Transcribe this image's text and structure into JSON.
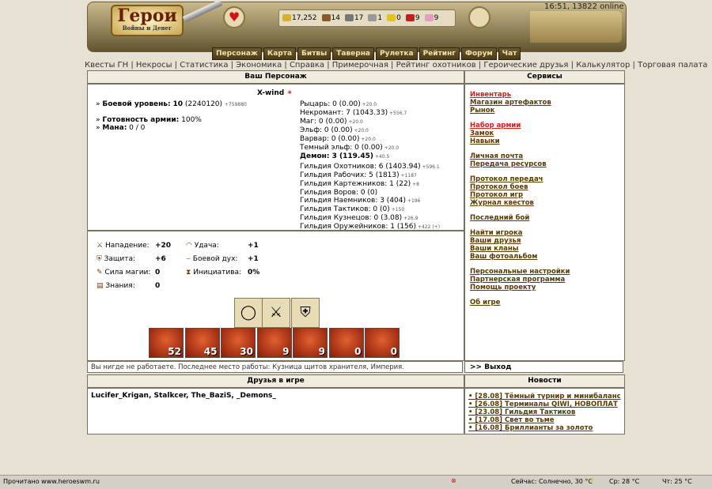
{
  "header": {
    "logo": "Герои",
    "logo_sub": "Войны и Денег",
    "clock": "16:51, 13822 online",
    "resources": [
      {
        "name": "gold",
        "value": "17,252",
        "color": "#d8b030"
      },
      {
        "name": "wood",
        "value": "14",
        "color": "#8a5a2a"
      },
      {
        "name": "ore",
        "value": "17",
        "color": "#777777"
      },
      {
        "name": "mercury",
        "value": "1",
        "color": "#999999"
      },
      {
        "name": "sulfur",
        "value": "0",
        "color": "#e8c020"
      },
      {
        "name": "crystals",
        "value": "9",
        "color": "#c02020"
      },
      {
        "name": "gems",
        "value": "9",
        "color": "#e0a0c0"
      }
    ]
  },
  "menu": [
    "Персонаж",
    "Карта",
    "Битвы",
    "Таверна",
    "Рулетка",
    "Рейтинг",
    "Форум",
    "Чат"
  ],
  "links": [
    "Квесты ГН",
    "Некросы",
    "Статистика",
    "Экономика",
    "Справка",
    "Примерочная",
    "Рейтинг охотников",
    "Героические друзья",
    "Калькулятор",
    "Торговая палата"
  ],
  "panels": {
    "character": "Ваш Персонаж",
    "services": "Сервисы",
    "friends": "Друзья в игре",
    "news": "Новости"
  },
  "character": {
    "name": "X-wind",
    "level_label": "Боевой уровень:",
    "level": "10",
    "level_exp": "(2240120)",
    "level_next": "+759880",
    "army_label": "Готовность армии:",
    "army": "100%",
    "mana_label": "Мана:",
    "mana": "0 / 0",
    "factions": [
      [
        "Рыцарь: 0 (0.00)",
        "+20.0"
      ],
      [
        "Некромант: 7 (1043.33)",
        "+556.7"
      ],
      [
        "Маг: 0 (0.00)",
        "+20.0"
      ],
      [
        "Эльф: 0 (0.00)",
        "+20.0"
      ],
      [
        "Варвар: 0 (0.00)",
        "+20.0"
      ],
      [
        "Темный эльф: 0 (0.00)",
        "+20.0"
      ],
      [
        "Демон: 3 (119.45)",
        "+40.5"
      ]
    ],
    "guilds": [
      [
        "Гильдия Охотников: 6 (1403.94)",
        "+596.1"
      ],
      [
        "Гильдия Рабочих: 5 (1813)",
        "+1187"
      ],
      [
        "Гильдия Картежников: 1 (22)",
        "+8"
      ],
      [
        "Гильдия Воров: 0 (0)",
        ""
      ],
      [
        "Гильдия Наемников: 3 (404)",
        "+196"
      ],
      [
        "Гильдия Тактиков: 0 (0)",
        "+150"
      ],
      [
        "Гильдия Кузнецов: 0 (3.08)",
        "+26.9"
      ],
      [
        "Гильдия Оружейников: 1 (156)",
        "+422 (+)"
      ]
    ]
  },
  "stats": [
    [
      "Нападение:",
      "+20"
    ],
    [
      "Защита:",
      "+6"
    ],
    [
      "Сила магии:",
      "0"
    ],
    [
      "Знания:",
      "0"
    ],
    [
      "Удача:",
      "+1"
    ],
    [
      "Боевой дух:",
      "+1"
    ],
    [
      "Инициатива:",
      "0%"
    ]
  ],
  "units": [
    "52",
    "45",
    "30",
    "9",
    "9",
    "0",
    "0"
  ],
  "work": "Вы нигде не работаете. Последнее место работы: Кузница щитов хранителя, Империя.",
  "exit": ">> Выход",
  "services": [
    [
      "Инвентарь",
      true
    ],
    [
      "Магазин артефактов",
      false
    ],
    [
      "Рынок",
      false
    ],
    [
      "",
      false
    ],
    [
      "Набор армии",
      true
    ],
    [
      "Замок",
      false
    ],
    [
      "Навыки",
      false
    ],
    [
      "",
      false
    ],
    [
      "Личная почта",
      false
    ],
    [
      "Передача ресурсов",
      false
    ],
    [
      "",
      false
    ],
    [
      "Протокол передач",
      false
    ],
    [
      "Протокол боев",
      false
    ],
    [
      "Протокол игр",
      false
    ],
    [
      "Журнал квестов",
      false
    ],
    [
      "",
      false
    ],
    [
      "Последний бой",
      false
    ],
    [
      "",
      false
    ],
    [
      "Найти игрока",
      false
    ],
    [
      "Ваши друзья",
      false
    ],
    [
      "Ваши кланы",
      false
    ],
    [
      "Ваш фотоальбом",
      false
    ],
    [
      "",
      false
    ],
    [
      "Персональные настройки",
      false
    ],
    [
      "Партнерская программа",
      false
    ],
    [
      "Помощь проекту",
      false
    ],
    [
      "",
      false
    ],
    [
      "Об игре",
      false
    ]
  ],
  "friends": [
    "Lucifer_Krigan,",
    "Stalkcer,",
    "The_BaziS,",
    "_Demons_"
  ],
  "news": [
    "[28.08] Тёмный турнир и минибаланс",
    "[26.08] Терминалы QIWI, НОВОПЛАТ",
    "[23.08] Гильдия Тактиков",
    "[17.08] Свет во тьме",
    "[16.08] Бриллианты за золото"
  ],
  "statusbar": {
    "left": "Прочитано www.heroeswm.ru",
    "weather": "Сейчас: Солнечно, 30 °C",
    "wed": "Ср: 28 °C",
    "thu": "Чт: 25 °C"
  }
}
